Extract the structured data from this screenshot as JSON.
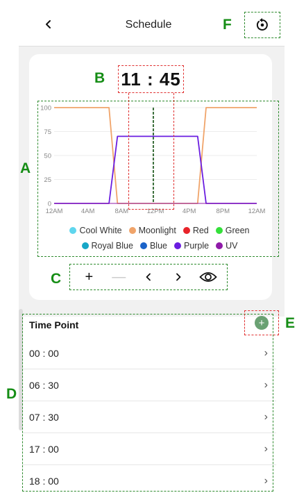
{
  "header": {
    "title": "Schedule",
    "back_icon": "chevron-left-icon",
    "reset_icon": "reset-icon"
  },
  "time": {
    "display": "11 : 45"
  },
  "annotations": {
    "a": "A",
    "b": "B",
    "c": "C",
    "d": "D",
    "e": "E",
    "f": "F"
  },
  "chart_data": {
    "type": "line",
    "x": [
      "00:00",
      "06:30",
      "07:30",
      "17:00",
      "18:00",
      "24:00"
    ],
    "x_ticks": [
      "12AM",
      "4AM",
      "8AM",
      "12PM",
      "4PM",
      "8PM",
      "12AM"
    ],
    "y_ticks": [
      "0",
      "25",
      "50",
      "75",
      "100"
    ],
    "ylim": [
      0,
      100
    ],
    "current_time": "11:45",
    "grid": true,
    "series": [
      {
        "name": "Cool White",
        "color": "#5fd6ee",
        "values": [
          0,
          0,
          0,
          0,
          0,
          0
        ]
      },
      {
        "name": "Moonlight",
        "color": "#f0a46a",
        "values": [
          100,
          100,
          0,
          0,
          100,
          100
        ]
      },
      {
        "name": "Red",
        "color": "#e8232a",
        "values": [
          0,
          0,
          0,
          0,
          0,
          0
        ]
      },
      {
        "name": "Green",
        "color": "#34e03a",
        "values": [
          0,
          0,
          0,
          0,
          0,
          0
        ]
      },
      {
        "name": "Royal Blue",
        "color": "#17a7c7",
        "values": [
          0,
          0,
          0,
          0,
          0,
          0
        ]
      },
      {
        "name": "Blue",
        "color": "#1a63c9",
        "values": [
          0,
          0,
          0,
          0,
          0,
          0
        ]
      },
      {
        "name": "Purple",
        "color": "#6a1de0",
        "values": [
          0,
          0,
          70,
          70,
          0,
          0
        ]
      },
      {
        "name": "UV",
        "color": "#8f1aa8",
        "values": [
          0,
          0,
          0,
          0,
          0,
          0
        ]
      }
    ]
  },
  "legend_rows": [
    [
      "Cool White",
      "Moonlight",
      "Red",
      "Green"
    ],
    [
      "Royal Blue",
      "Blue",
      "Purple",
      "UV"
    ]
  ],
  "controls": {
    "add_label": "+",
    "remove_label": "—",
    "prev_icon": "chevron-left-icon",
    "next_icon": "chevron-right-icon",
    "preview_icon": "eye-icon"
  },
  "timepoints": {
    "header": "Time Point",
    "add_icon": "plus-circle-icon",
    "add_label": "+",
    "items": [
      {
        "time": "00 : 00"
      },
      {
        "time": "06 : 30"
      },
      {
        "time": "07 : 30"
      },
      {
        "time": "17 : 00"
      },
      {
        "time": "18 : 00"
      }
    ],
    "chevron": "›"
  }
}
